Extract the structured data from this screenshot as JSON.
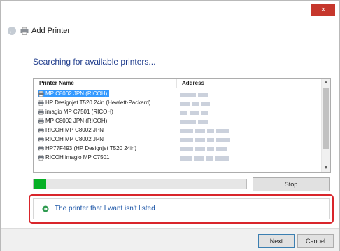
{
  "window": {
    "title": "Add Printer",
    "close_glyph": "×"
  },
  "heading": "Searching for available printers...",
  "list": {
    "columns": {
      "name": "Printer Name",
      "address": "Address"
    },
    "rows": [
      {
        "name": "MP C8002 JPN (RICOH)",
        "selected": true
      },
      {
        "name": "HP Designjet T520 24in (Hewlett-Packard)",
        "selected": false
      },
      {
        "name": "imagio MP C7501 (RICOH)",
        "selected": false
      },
      {
        "name": "MP C8002 JPN (RICOH)",
        "selected": false
      },
      {
        "name": "RICOH MP C8002 JPN",
        "selected": false
      },
      {
        "name": "RICOH MP C8002 JPN",
        "selected": false
      },
      {
        "name": "HP77F493 (HP Designjet T520 24in)",
        "selected": false
      },
      {
        "name": "RICOH imagio MP C7501",
        "selected": false
      }
    ]
  },
  "progress": {
    "percent": 6
  },
  "buttons": {
    "stop": "Stop",
    "next": "Next",
    "cancel": "Cancel"
  },
  "link": "The printer that I want isn't listed",
  "colors": {
    "accent": "#3399ff",
    "progress": "#06b025",
    "highlight": "#d9252b",
    "close": "#c6372c",
    "link": "#1e57a8",
    "heading": "#1f3c8c"
  },
  "icons": {
    "back": "back-arrow-icon",
    "printer": "printer-icon",
    "link": "arrow-right-icon"
  }
}
